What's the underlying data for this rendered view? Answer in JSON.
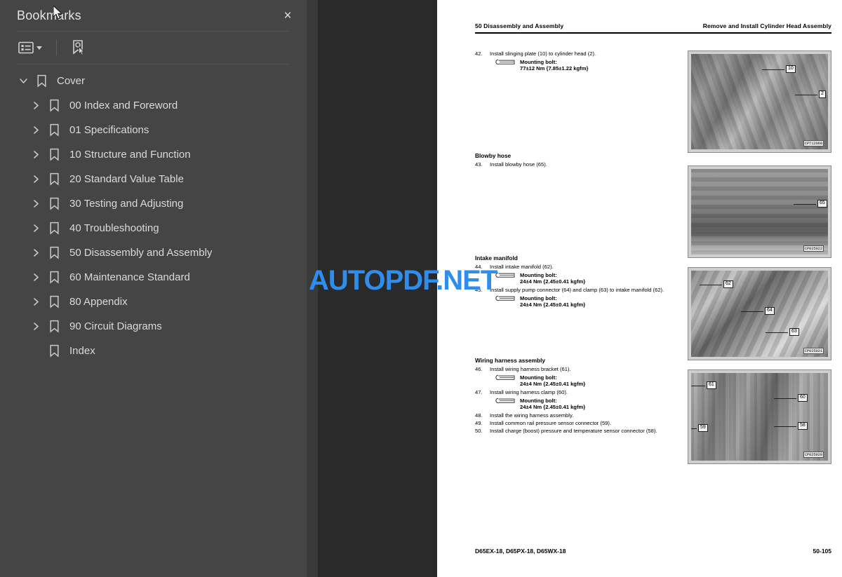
{
  "sidebar": {
    "title": "Bookmarks",
    "close_label": "×",
    "toolbar": {
      "list_options_icon": "list-options-icon",
      "dropdown_icon": "chevron-down-icon",
      "new_bookmark_icon": "new-bookmark-icon"
    },
    "items": [
      {
        "label": "Cover",
        "level": 0,
        "expanded": true,
        "has_children": true
      },
      {
        "label": "00 Index and Foreword",
        "level": 1,
        "expanded": false,
        "has_children": true
      },
      {
        "label": "01 Specifications",
        "level": 1,
        "expanded": false,
        "has_children": true
      },
      {
        "label": "10 Structure and Function",
        "level": 1,
        "expanded": false,
        "has_children": true
      },
      {
        "label": "20 Standard Value Table",
        "level": 1,
        "expanded": false,
        "has_children": true
      },
      {
        "label": "30 Testing and Adjusting",
        "level": 1,
        "expanded": false,
        "has_children": true
      },
      {
        "label": "40 Troubleshooting",
        "level": 1,
        "expanded": false,
        "has_children": true
      },
      {
        "label": "50 Disassembly and Assembly",
        "level": 1,
        "expanded": false,
        "has_children": true
      },
      {
        "label": "60 Maintenance Standard",
        "level": 1,
        "expanded": false,
        "has_children": true
      },
      {
        "label": "80 Appendix",
        "level": 1,
        "expanded": false,
        "has_children": true
      },
      {
        "label": "90 Circuit Diagrams",
        "level": 1,
        "expanded": false,
        "has_children": true
      },
      {
        "label": "Index",
        "level": 1,
        "expanded": false,
        "has_children": false
      }
    ]
  },
  "watermark": {
    "text": "AUTOPDF.NET",
    "color": "#2e8ded"
  },
  "document": {
    "header_left": "50 Disassembly and Assembly",
    "header_right": "Remove and Install Cylinder Head Assembly",
    "footer_left": "D65EX-18, D65PX-18, D65WX-18",
    "footer_right": "50-105",
    "blocks": [
      {
        "heading": "",
        "steps": [
          {
            "num": "42.",
            "text": "Install slinging plate (10) to cylinder head (2).",
            "bolt_label": "Mounting bolt:",
            "torque": "77±12 Nm {7.85±1.22 kgfm}"
          }
        ],
        "figure": {
          "caption": "CPT12060",
          "callouts": [
            "10",
            "2"
          ]
        }
      },
      {
        "heading": "Blowby hose",
        "steps": [
          {
            "num": "43.",
            "text": "Install blowby hose (65).",
            "bolt_label": "",
            "torque": ""
          }
        ],
        "figure": {
          "caption": "CP025922",
          "callouts": [
            "65"
          ]
        }
      },
      {
        "heading": "Intake manifold",
        "steps": [
          {
            "num": "44.",
            "text": "Install intake manifold (62).",
            "bolt_label": "Mounting bolt:",
            "torque": "24±4 Nm {2.45±0.41 kgfm}"
          },
          {
            "num": "45.",
            "text": "Install supply pump connector (64) and clamp (63) to intake manifold (62).",
            "bolt_label": "Mounting bolt:",
            "torque": "24±4 Nm {2.45±0.41 kgfm}"
          }
        ],
        "figure": {
          "caption": "CP025921",
          "callouts": [
            "62",
            "64",
            "63"
          ]
        }
      },
      {
        "heading": "Wiring harness assembly",
        "steps": [
          {
            "num": "46.",
            "text": "Install wiring harness bracket (61).",
            "bolt_label": "Mounting bolt:",
            "torque": "24±4 Nm {2.45±0.41 kgfm}"
          },
          {
            "num": "47.",
            "text": "Install wiring harness clamp (60).",
            "bolt_label": "Mounting bolt:",
            "torque": "24±4 Nm {2.45±0.41 kgfm}"
          },
          {
            "num": "48.",
            "text": "Install the wiring harness assembly.",
            "bolt_label": "",
            "torque": ""
          },
          {
            "num": "49.",
            "text": "Install common rail pressure sensor connector (59).",
            "bolt_label": "",
            "torque": ""
          },
          {
            "num": "50.",
            "text": "Install charge (boost) pressure and temperature sensor connector (58).",
            "bolt_label": "",
            "torque": ""
          }
        ],
        "figure": {
          "caption": "CP025920",
          "callouts": [
            "61",
            "60",
            "59",
            "58"
          ]
        }
      }
    ]
  }
}
